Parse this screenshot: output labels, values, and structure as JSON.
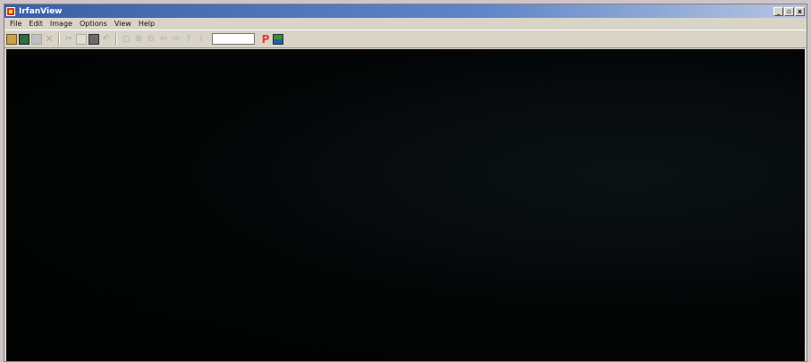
{
  "window": {
    "title": "IrfanView",
    "controls": {
      "minimize": "_",
      "maximize": "▫",
      "close": "x"
    }
  },
  "menu": {
    "items": [
      "File",
      "Edit",
      "Image",
      "Options",
      "View",
      "Help"
    ]
  },
  "toolbar": {
    "buttons": [
      {
        "name": "open-icon",
        "glyph": ""
      },
      {
        "name": "thumbnails-icon",
        "glyph": ""
      },
      {
        "name": "save-icon",
        "glyph": ""
      },
      {
        "name": "delete-icon",
        "glyph": "✕"
      },
      {
        "name": "cut-icon",
        "glyph": "✂"
      },
      {
        "name": "copy-icon",
        "glyph": ""
      },
      {
        "name": "paste-icon",
        "glyph": ""
      },
      {
        "name": "undo-icon",
        "glyph": "↶"
      },
      {
        "name": "fit-icon",
        "glyph": "◻"
      },
      {
        "name": "zoom-in-icon",
        "glyph": "⊕"
      },
      {
        "name": "zoom-out-icon",
        "glyph": "⊖"
      },
      {
        "name": "previous-icon",
        "glyph": "⇦"
      },
      {
        "name": "next-icon",
        "glyph": "⇨"
      },
      {
        "name": "help-icon",
        "glyph": "?"
      },
      {
        "name": "info-icon",
        "glyph": "i"
      }
    ],
    "page_field_value": "",
    "paint_glyph": "P"
  }
}
